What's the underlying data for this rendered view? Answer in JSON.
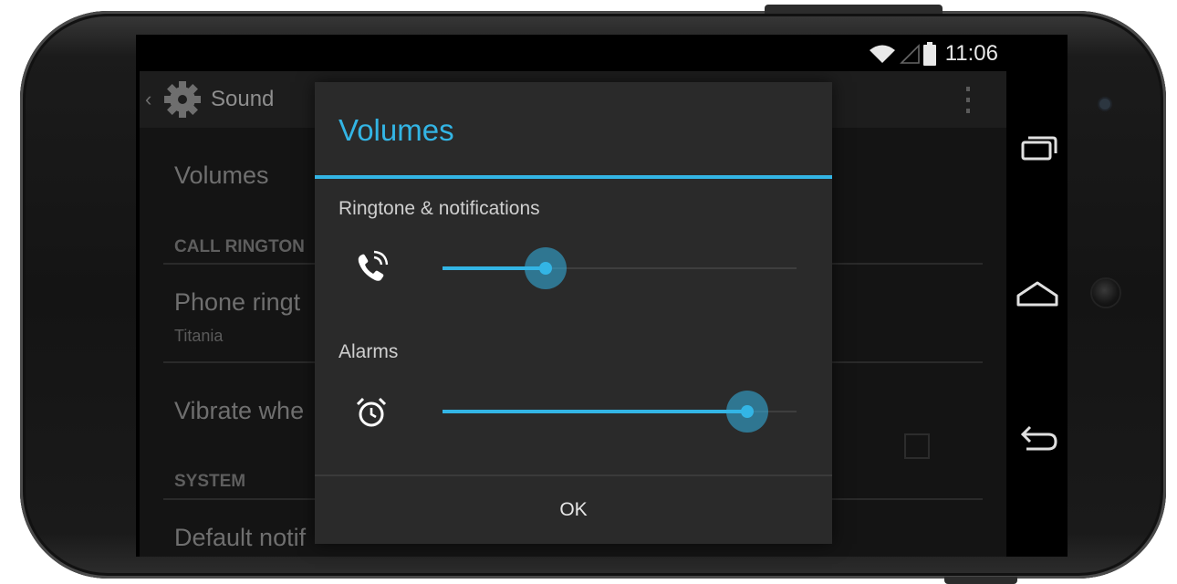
{
  "status_bar": {
    "time": "11:06",
    "icons": [
      "wifi-icon",
      "signal-icon",
      "battery-icon"
    ]
  },
  "action_bar": {
    "title": "Sound",
    "icons": [
      "back-chevron-icon",
      "settings-gear-icon",
      "overflow-menu-icon"
    ]
  },
  "settings": {
    "volumes": "Volumes",
    "call_ringtone_header": "CALL RINGTON",
    "phone_ringtone_title": "Phone ringt",
    "phone_ringtone_value": "Titania",
    "vibrate_title": "Vibrate whe",
    "system_header": "SYSTEM",
    "default_notification_title": "Default notif"
  },
  "dialog": {
    "title": "Volumes",
    "ringtone_label": "Ringtone & notifications",
    "ringtone_level": 0.29,
    "alarms_label": "Alarms",
    "alarms_level": 0.86,
    "ok_label": "OK"
  },
  "navigation": {
    "icons": [
      "recent-apps-icon",
      "home-icon",
      "back-icon"
    ]
  },
  "colors": {
    "accent": "#33b5e5",
    "dialog_bg": "#2a2a2a",
    "screen_bg": "#141414"
  }
}
